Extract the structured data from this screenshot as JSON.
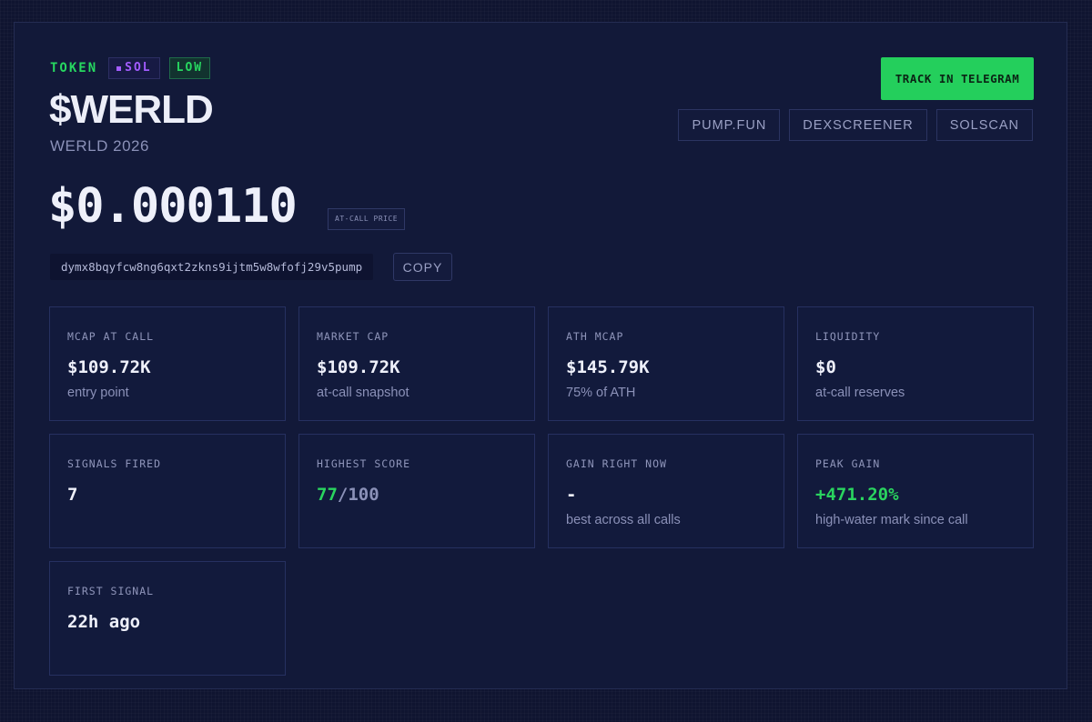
{
  "header": {
    "tag_token": "TOKEN",
    "tag_chain": "SOL",
    "tag_risk": "LOW",
    "symbol": "$WERLD",
    "name": "WERLD 2026",
    "price": "$0.000110",
    "price_badge": "AT-CALL PRICE",
    "address": "dymx8bqyfcw8ng6qxt2zkns9ijtm5w8wfofj29v5pump",
    "copy_label": "COPY"
  },
  "actions": {
    "telegram_label": "TRACK IN TELEGRAM",
    "links": [
      "PUMP.FUN",
      "DEXSCREENER",
      "SOLSCAN"
    ]
  },
  "stats": {
    "mcap_at_call": {
      "label": "MCAP AT CALL",
      "value": "$109.72K",
      "sub": "entry point"
    },
    "market_cap": {
      "label": "MARKET CAP",
      "value": "$109.72K",
      "sub": "at-call snapshot"
    },
    "ath_mcap": {
      "label": "ATH MCAP",
      "value": "$145.79K",
      "sub": "75% of ATH"
    },
    "liquidity": {
      "label": "LIQUIDITY",
      "value": "$0",
      "sub": "at-call reserves"
    },
    "signals_fired": {
      "label": "SIGNALS FIRED",
      "value": "7"
    },
    "highest_score": {
      "label": "HIGHEST SCORE",
      "score": "77",
      "max": "/100"
    },
    "gain_right_now": {
      "label": "GAIN RIGHT NOW",
      "value": "-",
      "sub": "best across all calls"
    },
    "peak_gain": {
      "label": "PEAK GAIN",
      "value": "+471.20%",
      "sub": "high-water mark since call"
    },
    "first_signal": {
      "label": "FIRST SIGNAL",
      "value": "22h ago"
    }
  },
  "colors": {
    "background": "#0f1430",
    "panel": "#121939",
    "accent_green": "#24cf5c",
    "chain_purple": "#a35cff",
    "text_muted": "#8b91b8"
  }
}
